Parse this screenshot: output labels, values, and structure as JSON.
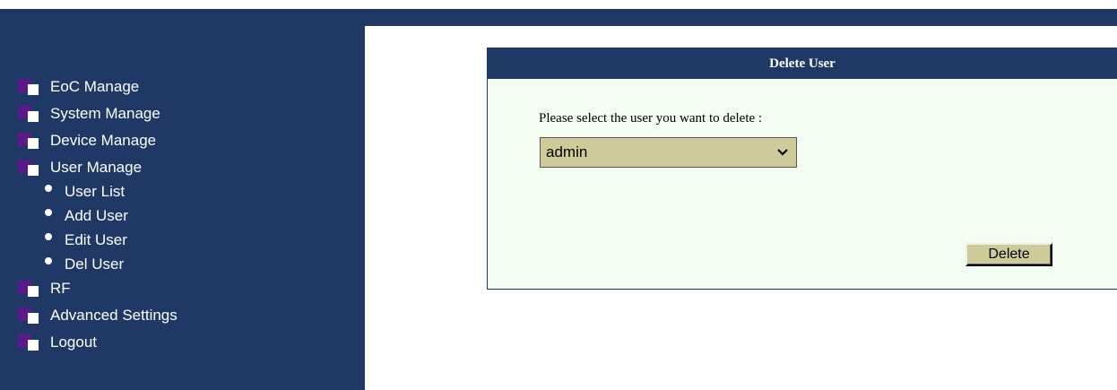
{
  "sidebar": {
    "items": [
      {
        "label": "EoC Manage"
      },
      {
        "label": "System Manage"
      },
      {
        "label": "Device Manage"
      },
      {
        "label": "User Manage"
      },
      {
        "label": "RF"
      },
      {
        "label": "Advanced Settings"
      },
      {
        "label": "Logout"
      }
    ],
    "user_manage_sub": [
      {
        "label": "User List"
      },
      {
        "label": "Add User"
      },
      {
        "label": "Edit User"
      },
      {
        "label": "Del User"
      }
    ]
  },
  "panel": {
    "title": "Delete User",
    "prompt": "Please select the user you want to delete :",
    "select_value": "admin",
    "delete_label": "Delete"
  },
  "colors": {
    "navy": "#1f3866",
    "panel_bg": "#f3fdf1",
    "control_bg": "#cdcb9a",
    "icon_purple": "#5b1a8a"
  }
}
